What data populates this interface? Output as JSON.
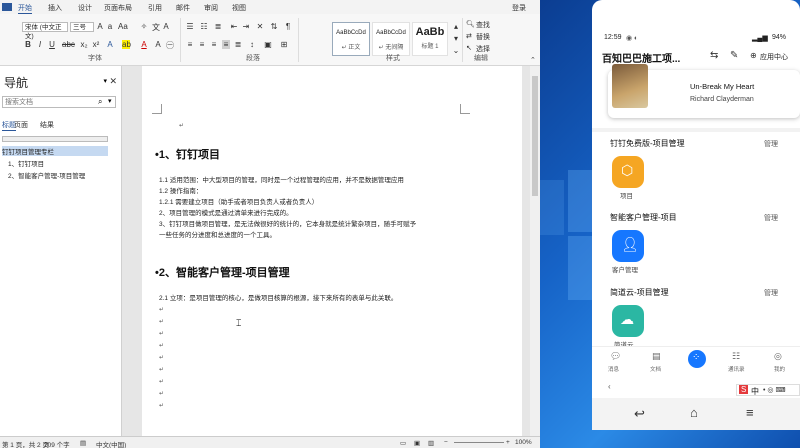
{
  "word": {
    "tabs": [
      "文件",
      "开始",
      "插入",
      "设计",
      "页面布局",
      "引用",
      "邮件",
      "审阅",
      "视图"
    ],
    "login": "登录",
    "ribbon": {
      "font_name": "宋体 (中文正文)",
      "font_size": "三号",
      "group_font": "字体",
      "group_paragraph": "段落",
      "group_styles": "样式",
      "group_edit": "编辑",
      "styles": [
        {
          "preview": "AaBbCcDd",
          "name": "↵ 正文"
        },
        {
          "preview": "AaBbCcDd",
          "name": "↵ 无间隔"
        },
        {
          "preview": "AaBb",
          "name": "标题 1"
        }
      ],
      "find": "查找",
      "replace": "替换",
      "select": "选择"
    },
    "nav": {
      "title": "导航",
      "search_placeholder": "搜索文档",
      "tabs": [
        "标题",
        "页面",
        "结果"
      ],
      "items": [
        {
          "label": "钉钉项目管理专栏",
          "selected": true
        },
        {
          "label": "1、钉钉项目",
          "selected": false
        },
        {
          "label": "2、智能客户管理-项目管理",
          "selected": false
        }
      ]
    },
    "doc": {
      "h1": "•1、钉钉项目",
      "lines1": [
        "1.1  适用范围：中大型项目的管理，同时是一个过程管理的应用，并不是数据管理应用",
        "1.2  操作指南：",
        "1.2.1  需要建立项目（助手或者项目负责人或者负责人）",
        "2、项目管理的模式是通过清单来进行完成的。",
        "3、钉钉项目做项目管理，是无法做很好的统计的，它本身就是统计繁杂项目，随手可赋予",
        "一些任务的分进度和总进度的一个工具。"
      ],
      "h2": "•2、智能客户管理-项目管理",
      "lines2": [
        "2.1  立项：是项目管理的核心，是做项目核算的根源，接下来所有的表单与此关联。"
      ]
    },
    "status": {
      "page": "第 1 页，共 2 页",
      "words": "209 个字",
      "lang": "中文(中国)",
      "zoom": "100%"
    }
  },
  "phone": {
    "time": "12:59",
    "battery": "94%",
    "title": "百知巴巴施工项...",
    "app_manage": "应用中心",
    "music": {
      "title": "Un-Break My Heart",
      "artist": "Richard Clayderman"
    },
    "sections": [
      {
        "title": "钉钉免费版-项目管理",
        "manage": "管理",
        "app": "项目",
        "color": "#f5a623"
      },
      {
        "title": "智能客户管理-项目",
        "manage": "管理",
        "app": "客户管理",
        "color": "#1677ff"
      },
      {
        "title": "简道云-项目管理",
        "manage": "管理",
        "app": "简道云",
        "color": "#2bb7a3"
      }
    ],
    "bottom_nav": [
      "消息",
      "文档",
      "工作台",
      "通讯录",
      "我的"
    ],
    "ime": "中"
  }
}
